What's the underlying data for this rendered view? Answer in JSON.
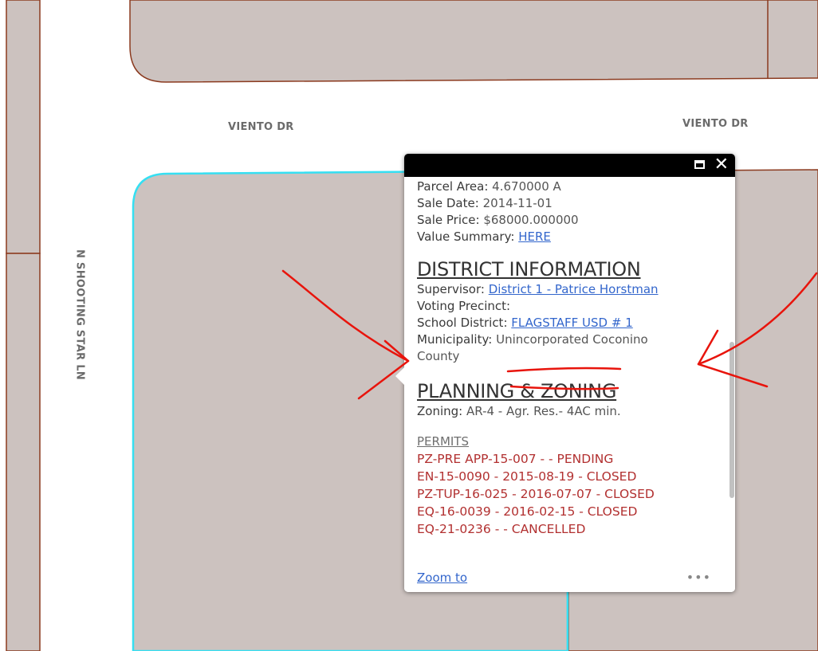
{
  "map": {
    "roads": {
      "horizontal_left": "VIENTO DR",
      "horizontal_right": "VIENTO DR",
      "vertical": "N SHOOTING STAR LN"
    },
    "colors": {
      "parcel_fill": "#ccc2bf",
      "parcel_border": "#8b3a1f",
      "selected_outline": "#35dff2",
      "annotation": "#e8140c"
    }
  },
  "popup": {
    "parcel": [
      {
        "label": "Parcel Area:",
        "value": "4.670000 A"
      },
      {
        "label": "Sale Date:",
        "value": "2014-11-01"
      },
      {
        "label": "Sale Price:",
        "value": "$68000.000000"
      }
    ],
    "value_summary": {
      "label": "Value Summary:",
      "link": "HERE"
    },
    "district": {
      "title": "DISTRICT INFORMATION",
      "supervisor_label": "Supervisor:",
      "supervisor_link": "District 1 - Patrice Horstman",
      "voting_label": "Voting Precinct:",
      "school_label": "School District:",
      "school_link": "FLAGSTAFF USD # 1",
      "municipality_label": "Municipality:",
      "municipality_value_line1": "Unincorporated Coconino",
      "municipality_value_line2": "County"
    },
    "planning": {
      "title": "PLANNING & ZONING",
      "zoning_label": "Zoning:",
      "zoning_value": "AR-4 - Agr. Res.- 4AC min.",
      "permits_heading": "PERMITS",
      "permits": [
        "PZ-PRE APP-15-007 - - PENDING",
        "EN-15-0090 - 2015-08-19 - CLOSED",
        "PZ-TUP-16-025 - 2016-07-07 - CLOSED",
        "EQ-16-0039 - 2016-02-15 - CLOSED",
        "EQ-21-0236 - - CANCELLED"
      ]
    },
    "footer": {
      "zoom_label": "Zoom to",
      "more_label": "•••"
    },
    "header": {
      "close_label": "✕"
    }
  }
}
